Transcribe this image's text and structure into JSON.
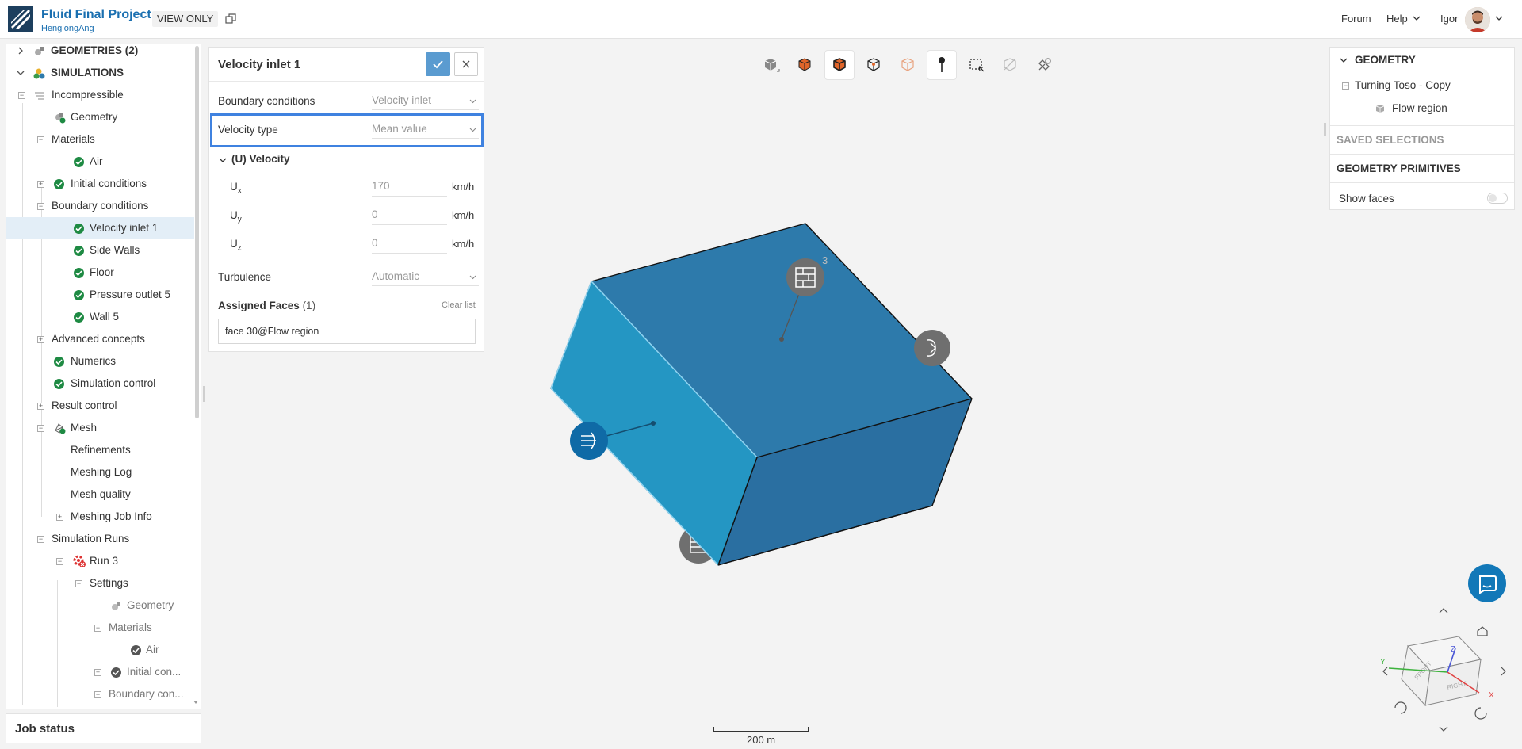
{
  "header": {
    "project_title": "Fluid Final Project",
    "project_owner": "HenglongAng",
    "view_only_label": "VIEW ONLY",
    "nav": {
      "forum": "Forum",
      "help": "Help",
      "user": "Igor"
    }
  },
  "tree": {
    "items": [
      {
        "label": "GEOMETRIES (2)"
      },
      {
        "label": "SIMULATIONS"
      },
      {
        "label": "Incompressible"
      },
      {
        "label": "Geometry"
      },
      {
        "label": "Materials"
      },
      {
        "label": "Air"
      },
      {
        "label": "Initial conditions"
      },
      {
        "label": "Boundary conditions"
      },
      {
        "label": "Velocity inlet 1"
      },
      {
        "label": "Side Walls"
      },
      {
        "label": "Floor"
      },
      {
        "label": "Pressure outlet 5"
      },
      {
        "label": "Wall 5"
      },
      {
        "label": "Advanced concepts"
      },
      {
        "label": "Numerics"
      },
      {
        "label": "Simulation control"
      },
      {
        "label": "Result control"
      },
      {
        "label": "Mesh"
      },
      {
        "label": "Refinements"
      },
      {
        "label": "Meshing Log"
      },
      {
        "label": "Mesh quality"
      },
      {
        "label": "Meshing Job Info"
      },
      {
        "label": "Simulation Runs"
      },
      {
        "label": "Run 3"
      },
      {
        "label": "Settings"
      },
      {
        "label": "Geometry"
      },
      {
        "label": "Materials"
      },
      {
        "label": "Air"
      },
      {
        "label": "Initial con..."
      },
      {
        "label": "Boundary con..."
      }
    ],
    "job_status": "Job status"
  },
  "velocity_panel": {
    "title": "Velocity inlet 1",
    "boundary_conditions_label": "Boundary conditions",
    "boundary_conditions_value": "Velocity inlet",
    "velocity_type_label": "Velocity type",
    "velocity_type_value": "Mean value",
    "section_label": "(U) Velocity",
    "components": [
      {
        "name": "U",
        "sub": "x",
        "value": "170",
        "unit": "km/h"
      },
      {
        "name": "U",
        "sub": "y",
        "value": "0",
        "unit": "km/h"
      },
      {
        "name": "U",
        "sub": "z",
        "value": "0",
        "unit": "km/h"
      }
    ],
    "turbulence_label": "Turbulence",
    "turbulence_value": "Automatic",
    "assigned_faces_label": "Assigned Faces",
    "assigned_faces_count": "(1)",
    "clear_list": "Clear list",
    "assigned_face": "face 30@Flow region"
  },
  "right_panel": {
    "geometry_header": "GEOMETRY",
    "geometry_name": "Turning Toso - Copy",
    "flow_region": "Flow region",
    "saved_selections": "SAVED SELECTIONS",
    "geometry_primitives": "GEOMETRY PRIMITIVES",
    "show_faces": "Show faces"
  },
  "viewport": {
    "scale_label": "200 m",
    "marker_number": "3",
    "nav_cube": {
      "front": "FRONT",
      "right": "RIGHT",
      "x": "X",
      "y": "Y",
      "z": "Z"
    }
  },
  "colors": {
    "accent": "#1a6fb0",
    "box_front": "#2496c3",
    "box_top": "#2d7aab",
    "box_side": "#2a6fa1",
    "check_green": "#1e8a43",
    "highlight_border": "#3f82e0"
  }
}
